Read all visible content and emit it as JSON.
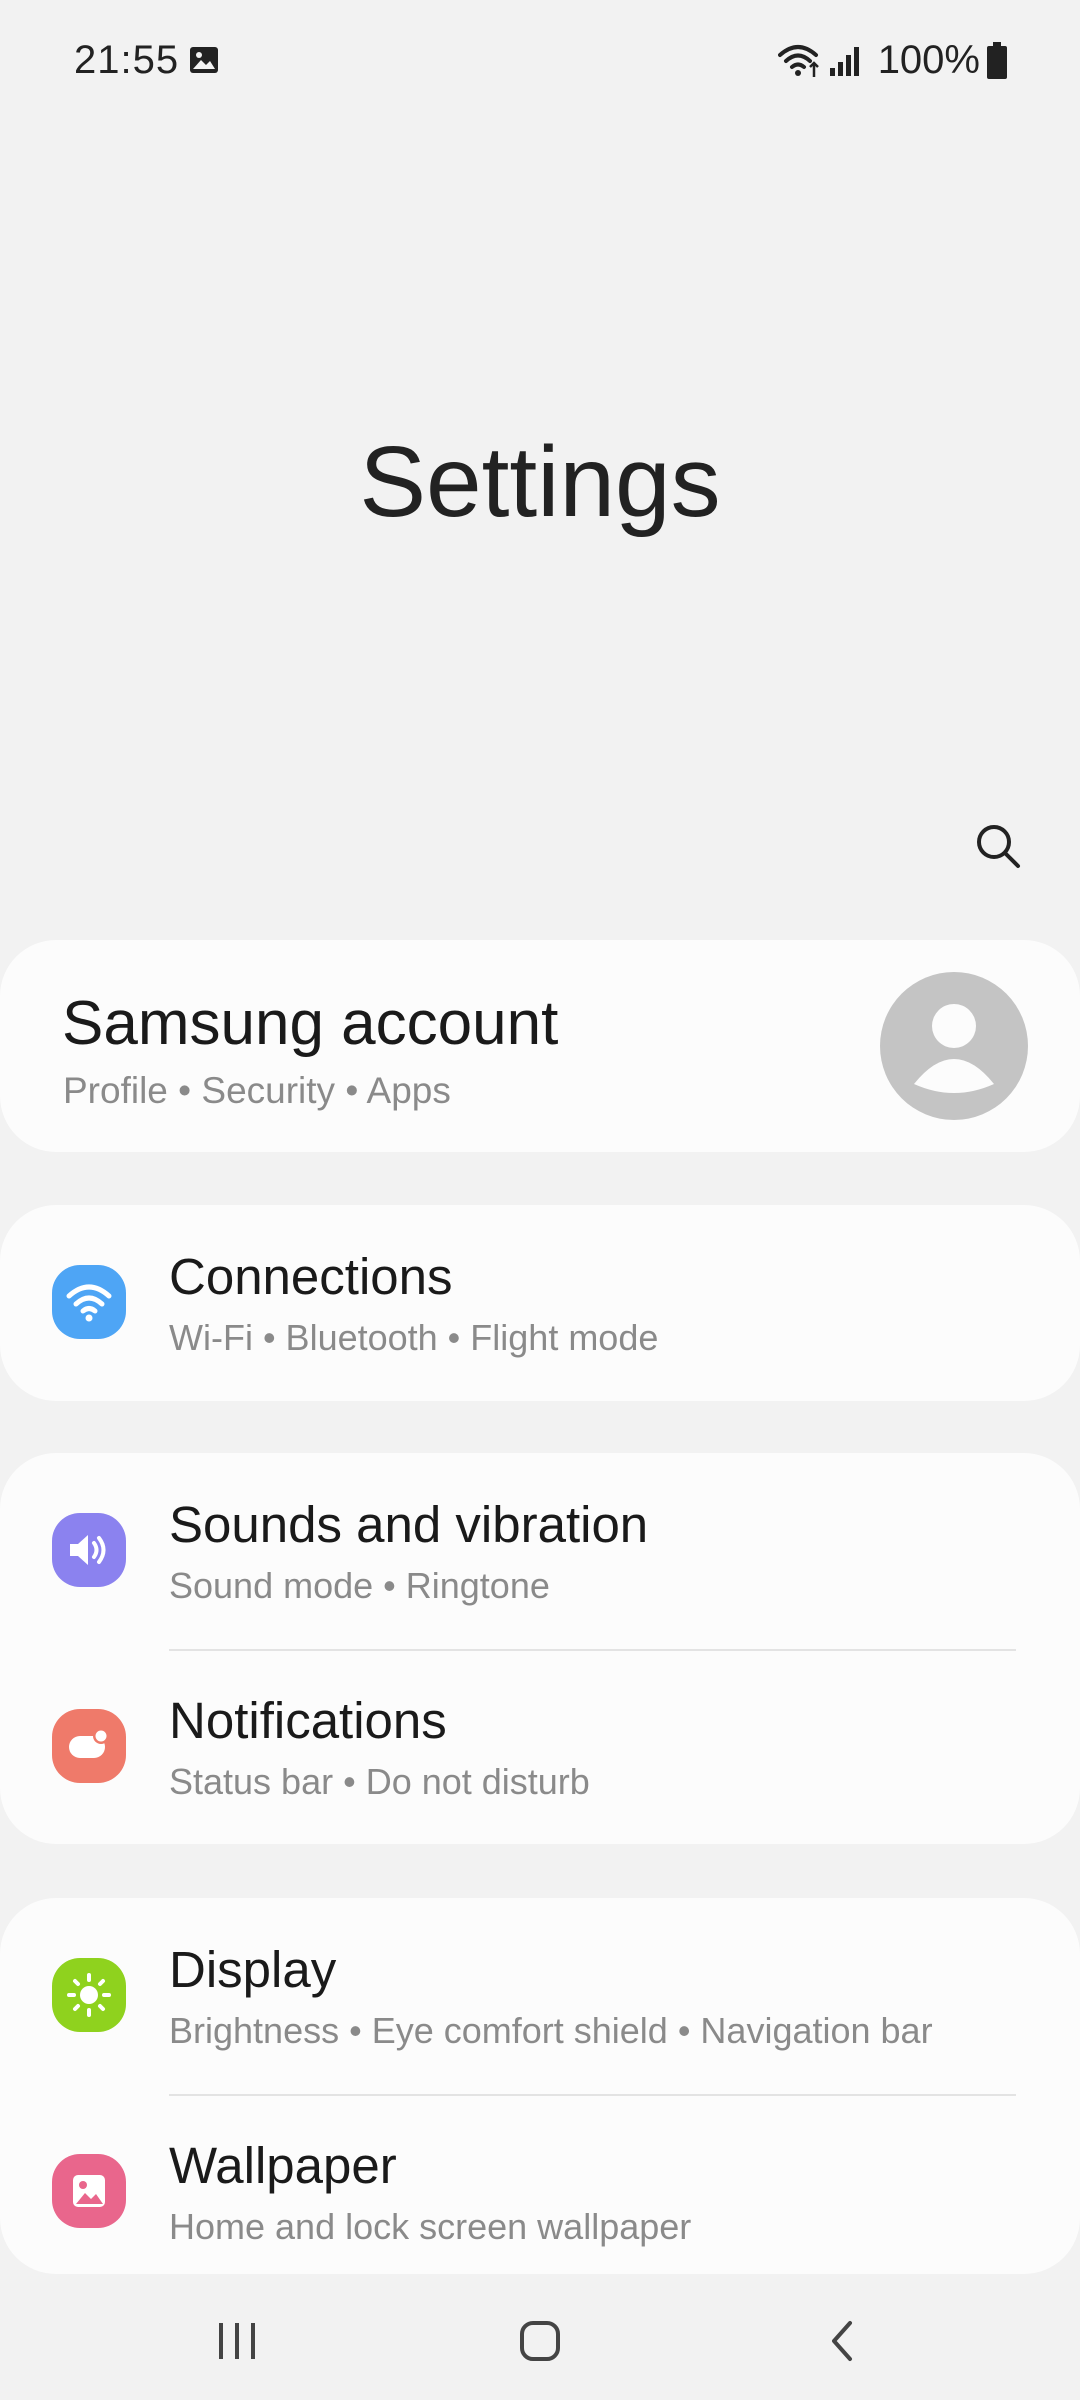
{
  "status_bar": {
    "time": "21:55",
    "battery": "100%"
  },
  "header": {
    "title": "Settings"
  },
  "account": {
    "title": "Samsung account",
    "subtitle": "Profile  •  Security  •  Apps"
  },
  "items": [
    {
      "title": "Connections",
      "subtitle": "Wi-Fi  •  Bluetooth  •  Flight mode",
      "icon": "wifi-icon",
      "color": "#4ea5f5"
    },
    {
      "title": "Sounds and vibration",
      "subtitle": "Sound mode  •  Ringtone",
      "icon": "volume-icon",
      "color": "#8b82ef"
    },
    {
      "title": "Notifications",
      "subtitle": "Status bar  •  Do not disturb",
      "icon": "notification-icon",
      "color": "#ef7a6a"
    },
    {
      "title": "Display",
      "subtitle": "Brightness  •  Eye comfort shield  •  Navigation bar",
      "icon": "sun-icon",
      "color": "#8fd21e"
    },
    {
      "title": "Wallpaper",
      "subtitle": "Home and lock screen wallpaper",
      "icon": "wallpaper-icon",
      "color": "#e9668c"
    }
  ]
}
